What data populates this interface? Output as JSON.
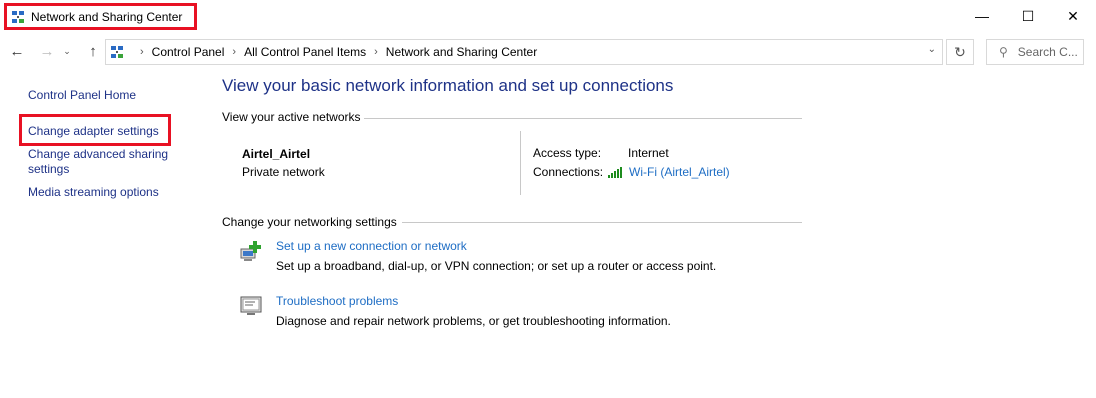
{
  "window": {
    "title": "Network and Sharing Center",
    "controls": {
      "minimize": "—",
      "maximize": "☐",
      "close": "✕"
    }
  },
  "nav": {
    "back": "←",
    "forward": "→",
    "recent": "⌄",
    "up": "↑",
    "breadcrumbs": [
      "Control Panel",
      "All Control Panel Items",
      "Network and Sharing Center"
    ],
    "separator": "›",
    "address_dropdown": "⌄",
    "refresh": "↻",
    "search_icon": "⚲",
    "search_placeholder": "Search C..."
  },
  "left_pane": {
    "links": [
      "Control Panel Home",
      "Change adapter settings",
      "Change advanced sharing settings",
      "Media streaming options"
    ]
  },
  "main": {
    "heading": "View your basic network information and set up connections",
    "active_networks": {
      "label": "View your active networks",
      "network_name": "Airtel_Airtel",
      "network_category": "Private network",
      "access_type_label": "Access type:",
      "access_type_value": "Internet",
      "connections_label": "Connections:",
      "connections_value": "Wi-Fi (Airtel_Airtel)"
    },
    "networking_settings": {
      "label": "Change your networking settings",
      "tasks": [
        {
          "icon": "network-setup-icon",
          "link": "Set up a new connection or network",
          "description": "Set up a broadband, dial-up, or VPN connection; or set up a router or access point."
        },
        {
          "icon": "troubleshoot-icon",
          "link": "Troubleshoot problems",
          "description": "Diagnose and repair network problems, or get troubleshooting information."
        }
      ]
    }
  },
  "colors": {
    "link": "#1e3287",
    "task_link": "#1e6dc4",
    "highlight": "#e81123",
    "signal": "#1e8c1e"
  }
}
